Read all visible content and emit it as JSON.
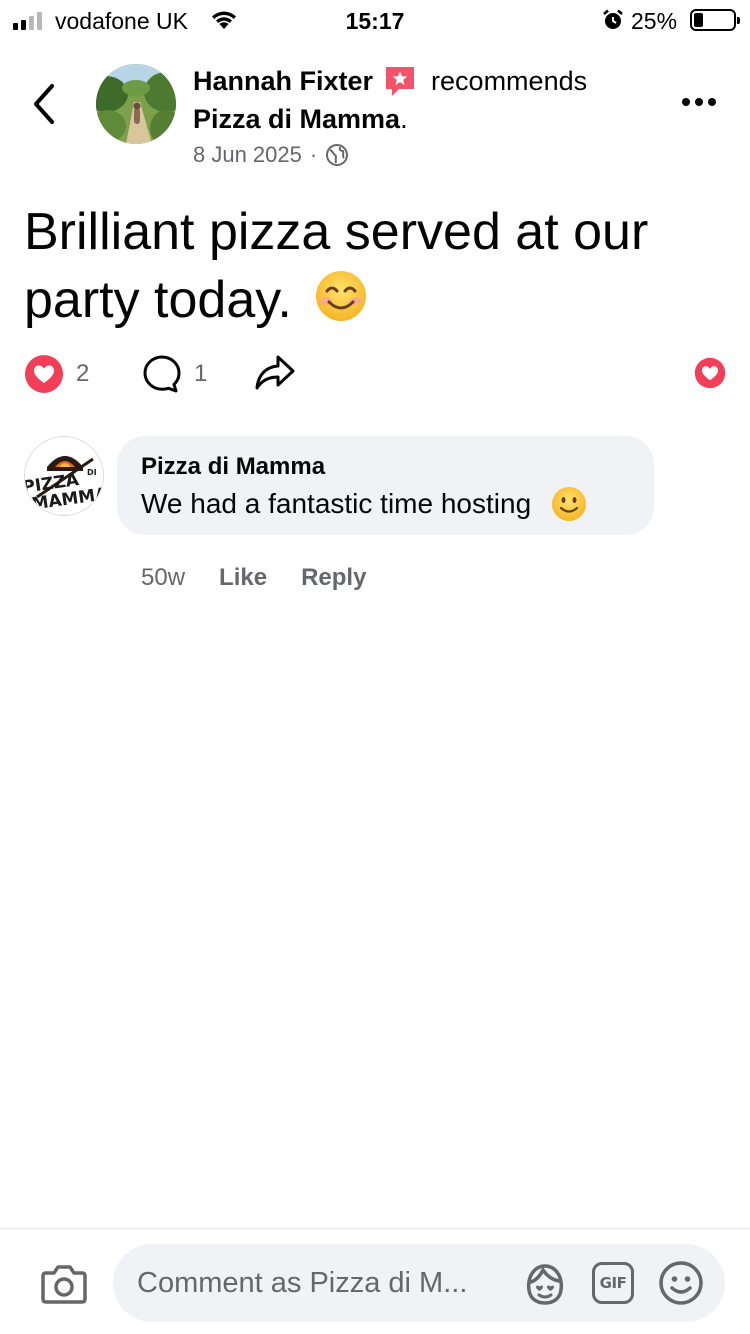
{
  "status_bar": {
    "carrier": "vodafone UK",
    "time": "15:17",
    "battery": "25%"
  },
  "header": {
    "author": "Hannah Fixter",
    "action_text": "recommends",
    "page_name": "Pizza di Mamma",
    "page_name_suffix": ".",
    "date": "8 Jun 2025",
    "separator": "·",
    "privacy_icon": "globe-icon"
  },
  "post": {
    "text": "Brilliant pizza served at our party today.",
    "emoji": "smiling-face-icon"
  },
  "actions": {
    "reaction_count": "2",
    "comment_count": "1",
    "colors": {
      "love": "#f33e58",
      "secondary_text": "#65676b"
    }
  },
  "comment": {
    "author": "Pizza di Mamma",
    "text": "We had a fantastic time hosting",
    "emoji": "slight-smile-icon",
    "avatar_logo_text": "PIZZA DI MAMMA",
    "age": "50w",
    "like_label": "Like",
    "reply_label": "Reply"
  },
  "composer": {
    "placeholder": "Comment as Pizza di M...",
    "gif_label": "GIF"
  }
}
